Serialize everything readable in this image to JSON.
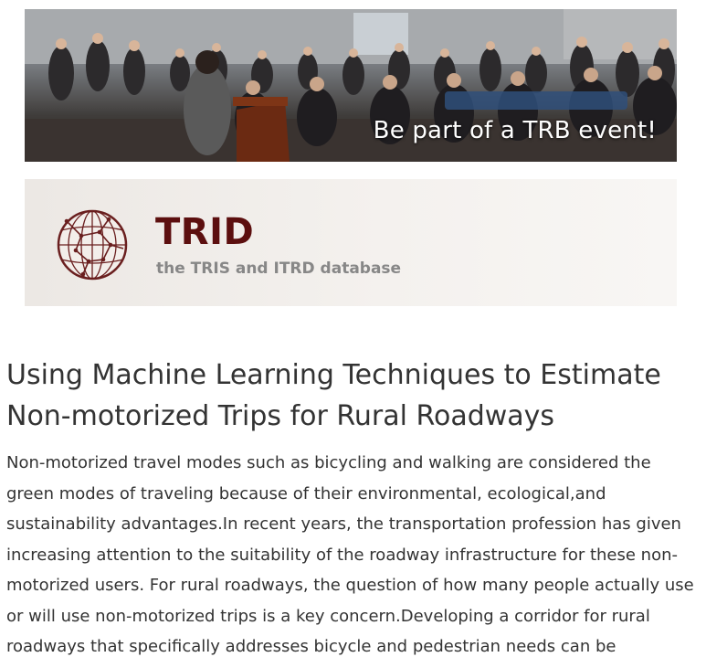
{
  "banner": {
    "caption": "Be part of a TRB event!"
  },
  "trid": {
    "title": "TRID",
    "subtitle": "the TRIS and ITRD database"
  },
  "article": {
    "title": "Using Machine Learning Techniques to Estimate Non-motorized Trips for Rural Roadways",
    "abstract": "Non-motorized travel modes such as bicycling and walking are considered the green modes of traveling because of their environmental, ecological,and sustainability advantages.In recent years, the transportation profession has given increasing attention to the suitability of the roadway infrastructure for these non-motorized users. For rural roadways, the question of how many people actually use or will use non-motorized trips is a key concern.Developing a corridor for rural roadways that specifically addresses bicycle and pedestrian needs can be"
  },
  "colors": {
    "trid_title": "#5c0f0f",
    "trid_subtitle": "#878787",
    "body_text": "#333333",
    "card_background": "#f1eeeb"
  },
  "icons": {
    "trid_logo": "globe-network-icon"
  }
}
